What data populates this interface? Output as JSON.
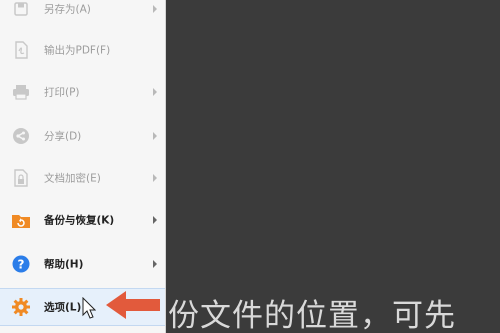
{
  "menu": {
    "items": [
      {
        "label": "另存为(A)",
        "icon": "save-as-icon"
      },
      {
        "label": "输出为PDF(F)",
        "icon": "pdf-export-icon"
      },
      {
        "label": "打印(P)",
        "icon": "printer-icon"
      },
      {
        "label": "分享(D)",
        "icon": "share-icon"
      },
      {
        "label": "文档加密(E)",
        "icon": "lock-document-icon"
      },
      {
        "label": "备份与恢复(K)",
        "icon": "backup-restore-icon"
      },
      {
        "label": "帮助(H)",
        "icon": "help-icon"
      },
      {
        "label": "选项(L)",
        "icon": "gear-icon"
      }
    ]
  },
  "subtitle": {
    "text": "份文件的位置，可先"
  },
  "colors": {
    "background_dark": "#3b3b3b",
    "menu_bg": "#f6f6f6",
    "selected_bg": "#e6f0fb",
    "accent_orange": "#f08a24",
    "help_blue": "#2b7de9",
    "arrow_red": "#e25a3c"
  }
}
